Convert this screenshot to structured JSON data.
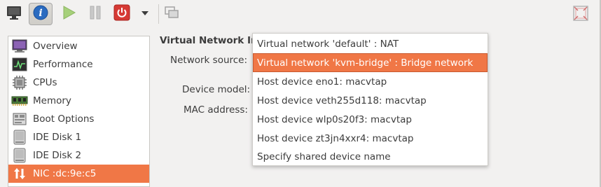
{
  "toolbar": {
    "buttons": [
      {
        "name": "console",
        "icon": "monitor-icon"
      },
      {
        "name": "details",
        "icon": "info-icon",
        "active": true
      },
      {
        "name": "run",
        "icon": "play-icon"
      },
      {
        "name": "pause",
        "icon": "pause-icon"
      },
      {
        "name": "shutdown",
        "icon": "power-icon"
      },
      {
        "name": "shutdown-menu",
        "icon": "chevron-down-icon"
      },
      {
        "name": "snapshots",
        "icon": "snapshots-icon"
      }
    ],
    "fullscreen_icon": "fullscreen-icon"
  },
  "sidebar": {
    "items": [
      {
        "label": "Overview",
        "icon": "overview-monitor-icon"
      },
      {
        "label": "Performance",
        "icon": "performance-graph-icon"
      },
      {
        "label": "CPUs",
        "icon": "cpu-chip-icon"
      },
      {
        "label": "Memory",
        "icon": "memory-module-icon"
      },
      {
        "label": "Boot Options",
        "icon": "boot-options-icon"
      },
      {
        "label": "IDE Disk 1",
        "icon": "disk-icon"
      },
      {
        "label": "IDE Disk 2",
        "icon": "disk-icon"
      },
      {
        "label": "NIC :dc:9e:c5",
        "icon": "network-arrows-icon",
        "selected": true
      }
    ]
  },
  "main": {
    "section_title": "Virtual Network Interface",
    "network_source_label": "Network source:",
    "device_model_label": "Device model:",
    "mac_address_label": "MAC address:"
  },
  "dropdown": {
    "options": [
      "Virtual network 'default' : NAT",
      "Virtual network 'kvm-bridge' : Bridge network",
      "Host device eno1: macvtap",
      "Host device veth255d118: macvtap",
      "Host device wlp0s20f3: macvtap",
      "Host device zt3jn4xxr4: macvtap",
      "Specify shared device name"
    ],
    "selected_index": 1
  },
  "colors": {
    "accent": "#f07746",
    "window_bg": "#f2f1f0",
    "power_red": "#d63a34",
    "info_blue": "#2a6bc0",
    "play_green": "#a6d07a"
  }
}
